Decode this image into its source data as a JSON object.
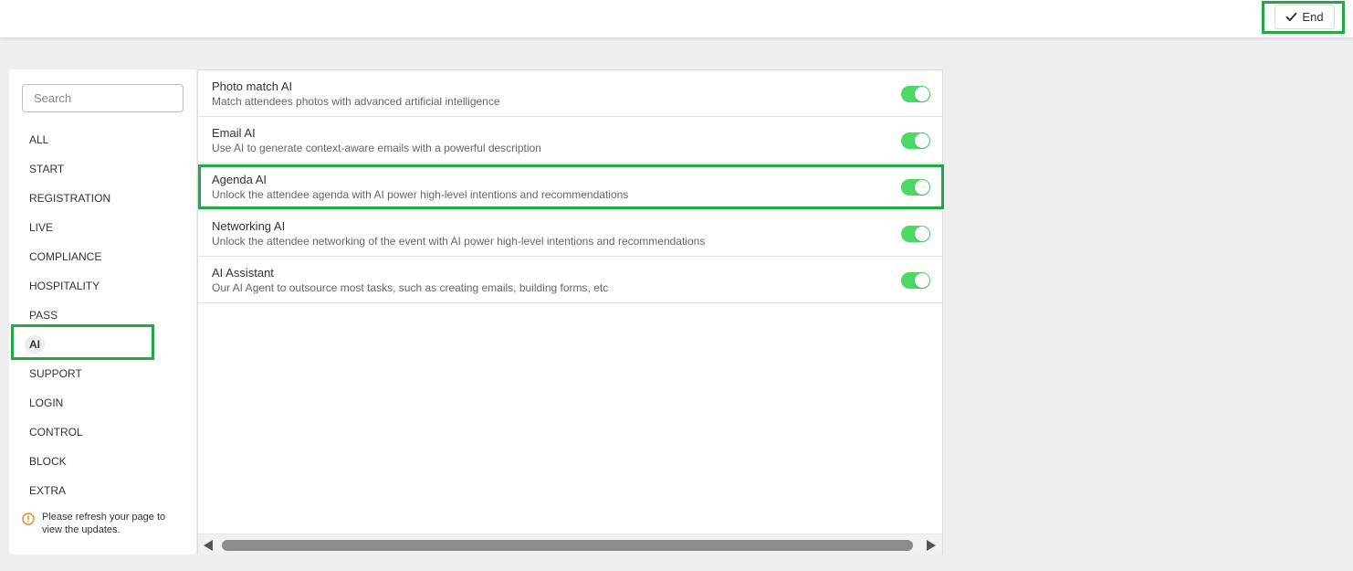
{
  "header": {
    "end_label": "End"
  },
  "sidebar": {
    "search_placeholder": "Search",
    "items": [
      {
        "label": "ALL"
      },
      {
        "label": "START"
      },
      {
        "label": "REGISTRATION"
      },
      {
        "label": "LIVE"
      },
      {
        "label": "COMPLIANCE"
      },
      {
        "label": "HOSPITALITY"
      },
      {
        "label": "PASS"
      },
      {
        "label": "AI"
      },
      {
        "label": "SUPPORT"
      },
      {
        "label": "LOGIN"
      },
      {
        "label": "CONTROL"
      },
      {
        "label": "BLOCK"
      },
      {
        "label": "EXTRA"
      }
    ],
    "active_item": "AI",
    "notice": "Please refresh your page to view the updates."
  },
  "features": [
    {
      "title": "Photo match AI",
      "description": "Match attendees photos with advanced artificial intelligence",
      "enabled": true
    },
    {
      "title": "Email AI",
      "description": "Use AI to generate context-aware emails with a powerful description",
      "enabled": true
    },
    {
      "title": "Agenda AI",
      "description": "Unlock the attendee agenda with AI power high-level intentions and recommendations",
      "enabled": true
    },
    {
      "title": "Networking AI",
      "description": "Unlock the attendee networking of the event with AI power high-level intentions and recommendations",
      "enabled": true
    },
    {
      "title": "AI Assistant",
      "description": "Our AI Agent to outsource most tasks, such as creating emails, building forms, etc",
      "enabled": true
    }
  ],
  "colors": {
    "accent": "#4cd964",
    "highlight": "#22a845",
    "notice_icon": "#e08a1e"
  }
}
